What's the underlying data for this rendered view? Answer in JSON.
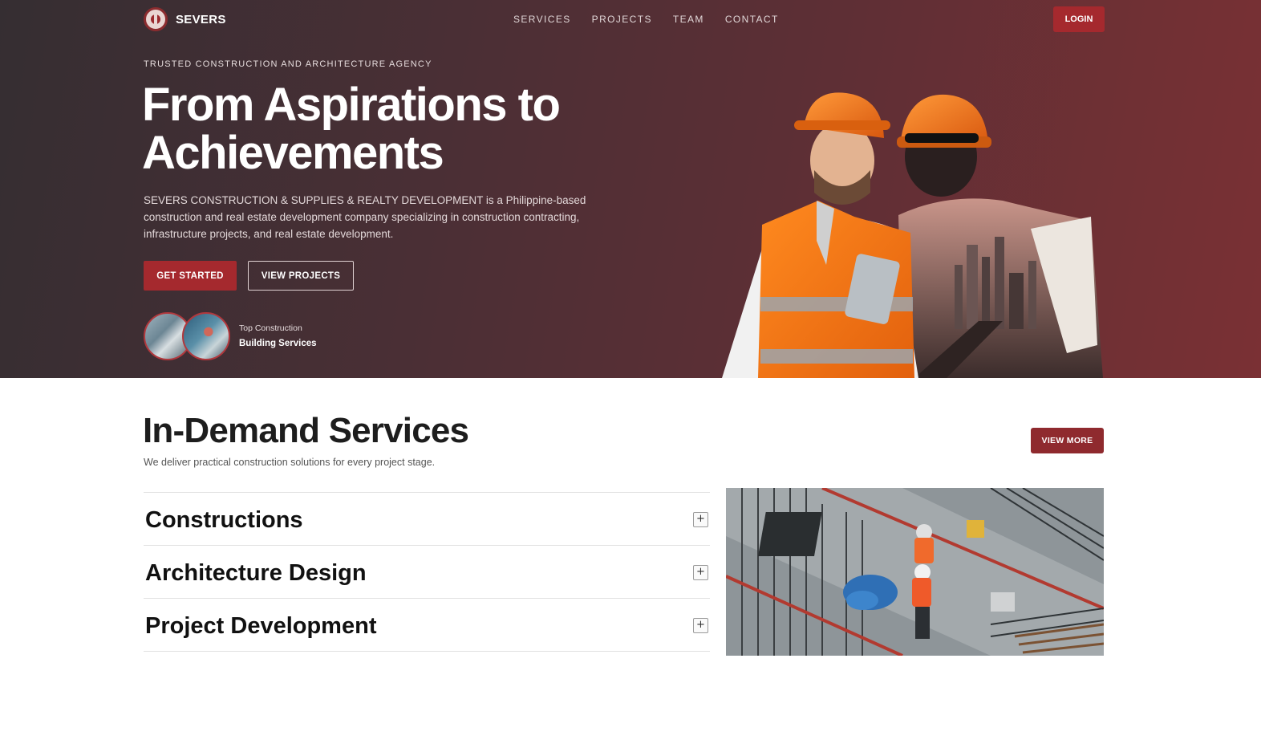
{
  "brand": {
    "name": "SEVERS"
  },
  "nav": {
    "links": [
      "SERVICES",
      "PROJECTS",
      "TEAM",
      "CONTACT"
    ],
    "login_label": "LOGIN"
  },
  "hero": {
    "eyebrow": "TRUSTED CONSTRUCTION AND ARCHITECTURE AGENCY",
    "title_line1": "From Aspirations to",
    "title_line2": "Achievements",
    "description": "SEVERS CONSTRUCTION & SUPPLIES & REALTY DEVELOPMENT is a Philippine-based construction and real estate development company specializing in construction contracting, infrastructure projects, and real estate development.",
    "primary_cta": "GET STARTED",
    "secondary_cta": "VIEW PROJECTS",
    "badge_small": "Top Construction",
    "badge_strong": "Building Services"
  },
  "services": {
    "title": "In-Demand Services",
    "subtitle": "We deliver practical construction solutions for every project stage.",
    "view_more_label": "VIEW MORE",
    "items": [
      {
        "label": "Constructions",
        "toggle": "+"
      },
      {
        "label": "Architecture Design",
        "toggle": "+"
      },
      {
        "label": "Project Development",
        "toggle": "+"
      }
    ]
  },
  "colors": {
    "accent": "#a5292e",
    "hero_gradient_start": "#352e32",
    "hero_gradient_end": "#7a3034"
  }
}
